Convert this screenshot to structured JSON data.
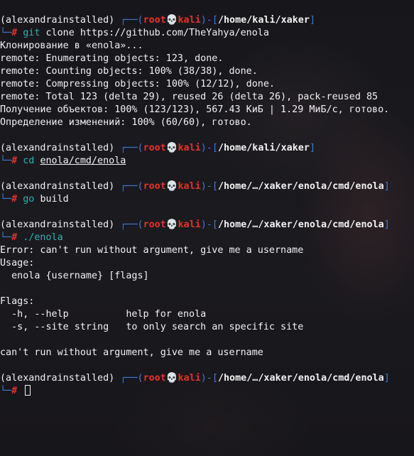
{
  "prompt": {
    "venv": "(alexandrainstalled)",
    "user": "root",
    "skull": "💀",
    "host": "kali"
  },
  "blocks": [
    {
      "path": "/home/kali/xaker",
      "command": "git",
      "args": "clone https://github.com/TheYahya/enola",
      "args_underlined": false,
      "output": [
        "Клонирование в «enola»...",
        "remote: Enumerating objects: 123, done.",
        "remote: Counting objects: 100% (38/38), done.",
        "remote: Compressing objects: 100% (12/12), done.",
        "remote: Total 123 (delta 29), reused 26 (delta 26), pack-reused 85",
        "Получение объектов: 100% (123/123), 567.43 КиБ | 1.29 МиБ/с, готово.",
        "Определение изменений: 100% (60/60), готово."
      ]
    },
    {
      "path": "/home/kali/xaker",
      "command": "cd",
      "args": "enola/cmd/enola",
      "args_underlined": true,
      "output": []
    },
    {
      "path": "/home/…/xaker/enola/cmd/enola",
      "command": "go",
      "args": "build",
      "args_underlined": false,
      "output": []
    },
    {
      "path": "/home/…/xaker/enola/cmd/enola",
      "command": "./enola",
      "args": "",
      "args_underlined": false,
      "output": [
        "Error: can't run without argument, give me a username",
        "Usage:",
        "  enola {username} [flags]",
        "",
        "Flags:",
        "  -h, --help          help for enola",
        "  -s, --site string   to only search an specific site",
        "",
        "can't run without argument, give me a username"
      ]
    },
    {
      "path": "/home/…/xaker/enola/cmd/enola",
      "command": "",
      "args": "",
      "args_underlined": false,
      "output": [],
      "active": true
    }
  ],
  "colors": {
    "prompt_blue": "#3a7bd5",
    "user_red": "#e5302b",
    "command_cyan": "#2ab3b3",
    "text": "#f2f2f2"
  }
}
